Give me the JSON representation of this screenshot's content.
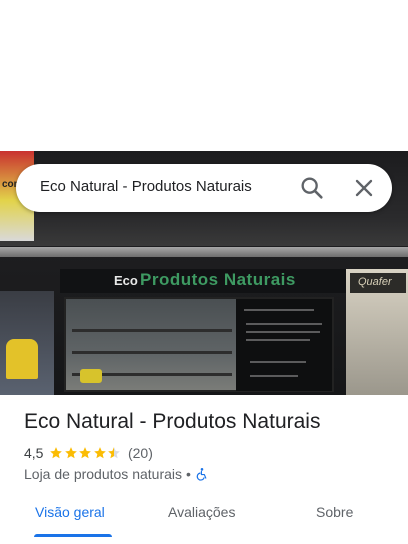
{
  "search": {
    "query": "Eco Natural - Produtos Naturais"
  },
  "photo": {
    "store_sign_prefix": "Eco",
    "store_sign_name": "Produtos Naturais",
    "left_sign_text": "comi",
    "right_sign_text": "Quafer"
  },
  "place": {
    "title": "Eco Natural - Produtos Naturais",
    "rating": "4,5",
    "stars_filled": 4.5,
    "reviews": "(20)",
    "category": "Loja de produtos naturais",
    "separator": "•"
  },
  "tabs": [
    {
      "label": "Visão geral",
      "active": true
    },
    {
      "label": "Avaliações",
      "active": false
    },
    {
      "label": "Sobre",
      "active": false
    }
  ],
  "colors": {
    "accent": "#1a73e8",
    "star": "#fbbc04",
    "accessibility_icon": "#1a73e8"
  }
}
